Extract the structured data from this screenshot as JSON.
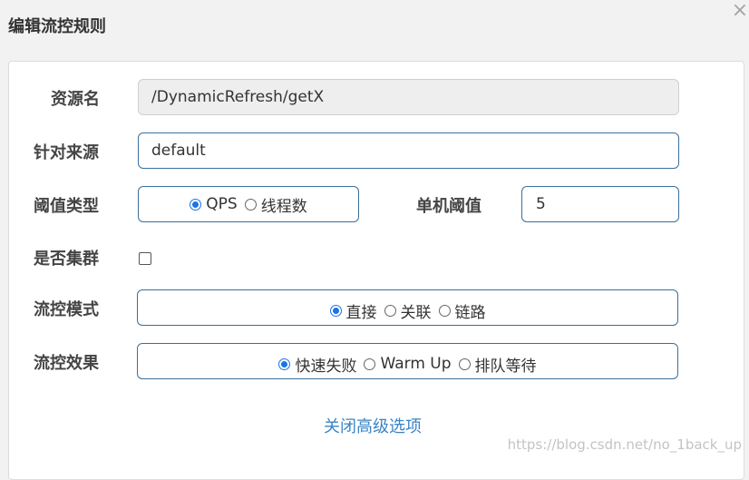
{
  "dialog": {
    "title": "编辑流控规则",
    "close_icon": "×"
  },
  "form": {
    "resource": {
      "label": "资源名",
      "value": "/DynamicRefresh/getX"
    },
    "source": {
      "label": "针对来源",
      "value": "default"
    },
    "threshold_type": {
      "label": "阈值类型",
      "options": [
        "QPS",
        "线程数"
      ],
      "selected": "QPS"
    },
    "threshold": {
      "label": "单机阈值",
      "value": "5"
    },
    "cluster": {
      "label": "是否集群",
      "checked": false
    },
    "mode": {
      "label": "流控模式",
      "options": [
        "直接",
        "关联",
        "链路"
      ],
      "selected": "直接"
    },
    "effect": {
      "label": "流控效果",
      "options": [
        "快速失败",
        "Warm Up",
        "排队等待"
      ],
      "selected": "快速失败"
    },
    "toggle_advanced": "关闭高级选项"
  },
  "watermark": "https://blog.csdn.net/no_1back_up"
}
